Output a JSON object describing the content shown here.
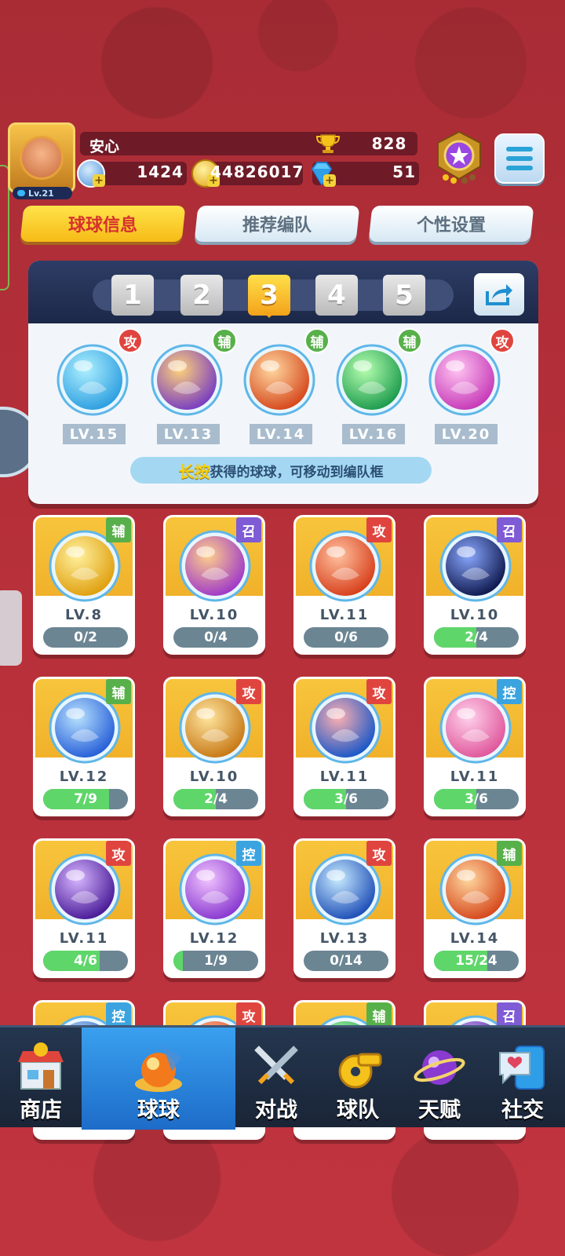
{
  "player": {
    "name": "安心",
    "level": "Lv.21",
    "trophies": "828",
    "stamina": "1424",
    "coins": "44826017",
    "gems": "51"
  },
  "tabs": [
    {
      "label": "球球信息",
      "active": true
    },
    {
      "label": "推荐编队",
      "active": false
    },
    {
      "label": "个性设置",
      "active": false
    }
  ],
  "formation": {
    "slots": [
      "1",
      "2",
      "3",
      "4",
      "5"
    ],
    "active_slot": "3",
    "team": [
      {
        "tag": "攻",
        "tag_type": "atk",
        "level": "LV.15",
        "colors": [
          "#aef0ff",
          "#2fa0e0"
        ],
        "icon": "trident-orb-icon"
      },
      {
        "tag": "辅",
        "tag_type": "sup",
        "level": "LV.13",
        "colors": [
          "#ffd27a",
          "#7a3fc0"
        ],
        "icon": "twins-orb-icon"
      },
      {
        "tag": "辅",
        "tag_type": "sup",
        "level": "LV.14",
        "colors": [
          "#ffd8a0",
          "#d64a1e"
        ],
        "icon": "wings-orb-icon"
      },
      {
        "tag": "辅",
        "tag_type": "sup",
        "level": "LV.16",
        "colors": [
          "#b6ffb0",
          "#1f9c4e"
        ],
        "icon": "arrow-orb-icon"
      },
      {
        "tag": "攻",
        "tag_type": "atk",
        "level": "LV.20",
        "colors": [
          "#ffc4f2",
          "#c73bb8"
        ],
        "icon": "shield-orb-icon"
      }
    ],
    "hint_key": "长按",
    "hint_text": "获得的球球，可移动到编队框"
  },
  "cards": [
    {
      "tag": "辅",
      "tag_type": "sup",
      "level": "LV.8",
      "progress": "0/2",
      "fill": 0.0,
      "colors": [
        "#fff2a0",
        "#e0a010"
      ],
      "icon": "piggy-orb-icon"
    },
    {
      "tag": "召",
      "tag_type": "sum",
      "level": "LV.10",
      "progress": "0/4",
      "fill": 0.0,
      "colors": [
        "#ffd08a",
        "#a03ac8"
      ],
      "icon": "phoenix-orb-icon"
    },
    {
      "tag": "攻",
      "tag_type": "atk",
      "level": "LV.11",
      "progress": "0/6",
      "fill": 0.0,
      "colors": [
        "#ffc2a0",
        "#d8401c"
      ],
      "icon": "scroll-orb-icon"
    },
    {
      "tag": "召",
      "tag_type": "sum",
      "level": "LV.10",
      "progress": "2/4",
      "fill": 0.5,
      "colors": [
        "#8aa8ff",
        "#101a50"
      ],
      "icon": "void-orb-icon"
    },
    {
      "tag": "辅",
      "tag_type": "sup",
      "level": "LV.12",
      "progress": "7/9",
      "fill": 0.78,
      "colors": [
        "#b8e2ff",
        "#2860d8"
      ],
      "icon": "crystal-orb-icon"
    },
    {
      "tag": "攻",
      "tag_type": "atk",
      "level": "LV.10",
      "progress": "2/4",
      "fill": 0.5,
      "colors": [
        "#ffe6a0",
        "#c87a18"
      ],
      "icon": "helmet-orb-icon"
    },
    {
      "tag": "攻",
      "tag_type": "atk",
      "level": "LV.11",
      "progress": "3/6",
      "fill": 0.5,
      "colors": [
        "#ffb0b0",
        "#1c58c8"
      ],
      "icon": "taiji-orb-icon"
    },
    {
      "tag": "控",
      "tag_type": "ctl",
      "level": "LV.11",
      "progress": "3/6",
      "fill": 0.5,
      "colors": [
        "#ffd2ec",
        "#e0589c"
      ],
      "icon": "heart-orb-icon"
    },
    {
      "tag": "攻",
      "tag_type": "atk",
      "level": "LV.11",
      "progress": "4/6",
      "fill": 0.67,
      "colors": [
        "#d8b6ff",
        "#4a1c98"
      ],
      "icon": "sword-orb-icon"
    },
    {
      "tag": "控",
      "tag_type": "ctl",
      "level": "LV.12",
      "progress": "1/9",
      "fill": 0.11,
      "colors": [
        "#f2c4ff",
        "#8a3ad0"
      ],
      "icon": "butterfly-orb-icon"
    },
    {
      "tag": "攻",
      "tag_type": "atk",
      "level": "LV.13",
      "progress": "0/14",
      "fill": 0.0,
      "colors": [
        "#c8ecff",
        "#2050b8"
      ],
      "icon": "swirl-orb-icon"
    },
    {
      "tag": "辅",
      "tag_type": "sup",
      "level": "LV.14",
      "progress": "15/24",
      "fill": 0.63,
      "colors": [
        "#ffd8a0",
        "#d64a1e"
      ],
      "icon": "wings-orb-icon"
    },
    {
      "tag": "控",
      "tag_type": "ctl",
      "level": "",
      "progress": "",
      "fill": 0.0,
      "colors": [
        "#c8ecff",
        "#2050b8"
      ],
      "icon": "orb-icon"
    },
    {
      "tag": "攻",
      "tag_type": "atk",
      "level": "",
      "progress": "",
      "fill": 0.0,
      "colors": [
        "#ffc2a0",
        "#d8401c"
      ],
      "icon": "orb-icon"
    },
    {
      "tag": "辅",
      "tag_type": "sup",
      "level": "",
      "progress": "",
      "fill": 0.0,
      "colors": [
        "#b6ffb0",
        "#1f9c4e"
      ],
      "icon": "orb-icon"
    },
    {
      "tag": "召",
      "tag_type": "sum",
      "level": "",
      "progress": "",
      "fill": 0.0,
      "colors": [
        "#d8b6ff",
        "#4a1c98"
      ],
      "icon": "orb-icon"
    }
  ],
  "bottom_nav": [
    {
      "label": "商店",
      "icon": "shop-icon",
      "active": false
    },
    {
      "label": "球球",
      "icon": "ball-icon",
      "active": true
    },
    {
      "label": "对战",
      "icon": "crossed-swords-icon",
      "active": false
    },
    {
      "label": "球队",
      "icon": "whistle-icon",
      "active": false
    },
    {
      "label": "天赋",
      "icon": "planet-icon",
      "active": false
    },
    {
      "label": "社交",
      "icon": "chat-heart-icon",
      "active": false
    }
  ]
}
